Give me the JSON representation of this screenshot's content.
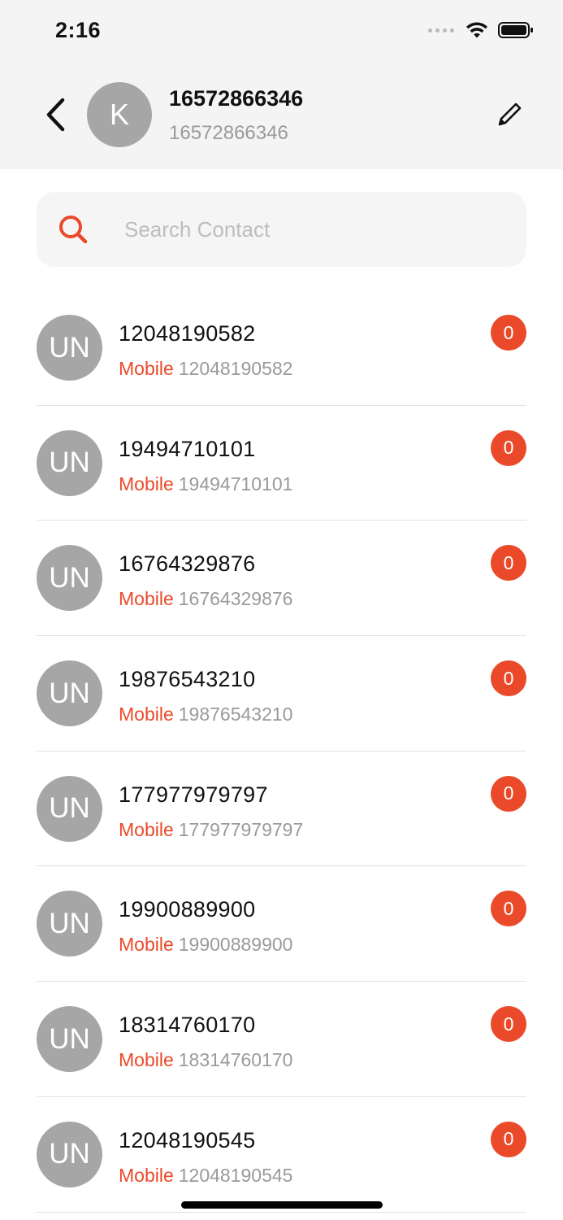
{
  "status_bar": {
    "time": "2:16",
    "icons": [
      "signal-icon",
      "wifi-icon",
      "battery-icon"
    ]
  },
  "header": {
    "avatar_initial": "K",
    "name": "16572866346",
    "subtitle": "16572866346",
    "icons": {
      "back": "chevron-left-icon",
      "edit": "pencil-icon"
    }
  },
  "search": {
    "placeholder": "Search Contact",
    "value": "",
    "icon": "search-icon"
  },
  "colors": {
    "accent": "#ea4a2a",
    "avatar": "#a6a6a6",
    "header_bg": "#f4f4f4",
    "muted_text": "#9a9a9a"
  },
  "contacts": [
    {
      "initials": "UN",
      "name": "12048190582",
      "type": "Mobile",
      "number": "12048190582",
      "unread": "0"
    },
    {
      "initials": "UN",
      "name": "19494710101",
      "type": "Mobile",
      "number": "19494710101",
      "unread": "0"
    },
    {
      "initials": "UN",
      "name": "16764329876",
      "type": "Mobile",
      "number": "16764329876",
      "unread": "0"
    },
    {
      "initials": "UN",
      "name": "19876543210",
      "type": "Mobile",
      "number": "19876543210",
      "unread": "0"
    },
    {
      "initials": "UN",
      "name": "177977979797",
      "type": "Mobile",
      "number": "177977979797",
      "unread": "0"
    },
    {
      "initials": "UN",
      "name": "19900889900",
      "type": "Mobile",
      "number": "19900889900",
      "unread": "0"
    },
    {
      "initials": "UN",
      "name": "18314760170",
      "type": "Mobile",
      "number": "18314760170",
      "unread": "0"
    },
    {
      "initials": "UN",
      "name": "12048190545",
      "type": "Mobile",
      "number": "12048190545",
      "unread": "0"
    }
  ]
}
